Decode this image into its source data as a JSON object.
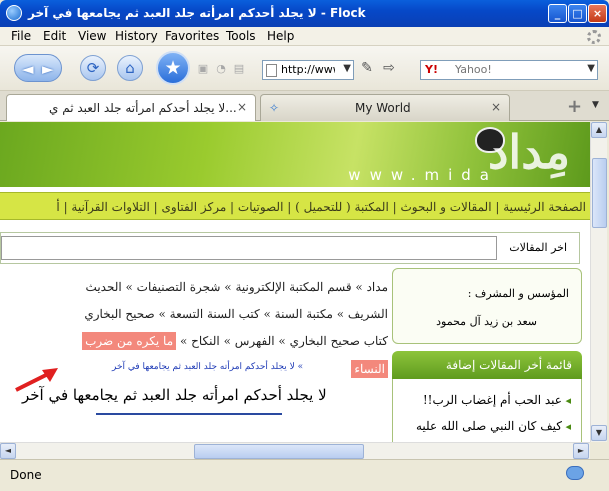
{
  "window": {
    "title": "لا يجلد أحدكم امرأته جلد العبد ثم يجامعها في آخر - Flock",
    "minimize": "_",
    "maximize": "□",
    "close": "×"
  },
  "menu": [
    "File",
    "Edit",
    "View",
    "History",
    "Favorites",
    "Tools",
    "Help"
  ],
  "toolbar": {
    "back_glyph": "◄",
    "forward_glyph": "►",
    "reload_glyph": "⟳",
    "home_glyph": "⌂",
    "star_glyph": "★",
    "url": "http://www.mi",
    "search_placeholder": "Yahoo!",
    "search_logo": "Y!"
  },
  "tabs": [
    {
      "label": "لا يجلد أحدكم امرأته جلد العبد ثم ي...",
      "close": "×"
    },
    {
      "label": "My World",
      "close": "×"
    }
  ],
  "new_tab": "+",
  "site": {
    "logo": "مِداد",
    "url_text": "www.mida",
    "nav": "الصفحة الرئيسية | المقالات و البحوث | المكتبة ( للتحميل ) | الصوتيات | مركز الفتاوى | التلاوات القرآنية | أ",
    "latest_label": "اخر المقالات",
    "founder_label": "المؤسس و المشرف :",
    "founder_name": "سعد بن زيد آل محمود",
    "latest_header": "قائمة أخر المقالات إضافة",
    "latest_items": [
      "عبد الحب أم إغضاب الرب!!",
      "كيف كان النبي صلى الله عليه"
    ],
    "bread1": "مداد » قسم المكتبة الإلكترونية » شجرة التصنيفات » الحديث",
    "bread2": "الشريف » مكتبة السنة » كتب السنة التسعة » صحيح البخاري",
    "bread3_pre": "كتاب صحيح البخاري » الفهرس » النكاح »",
    "bread3_hl": "ما يكره من ضرب",
    "bread4_hl": "النساء",
    "bread4_link": "» لا يجلد أحدكم امرأته جلد العبد ثم يجامعها في آخر",
    "article_title": "لا يجلد أحدكم امرأته جلد العبد ثم يجامعها في آخر"
  },
  "status": "Done",
  "colors": {
    "accent": "#0a5fdc",
    "site_green": "#8dc43b",
    "highlight": "#f3887c"
  }
}
